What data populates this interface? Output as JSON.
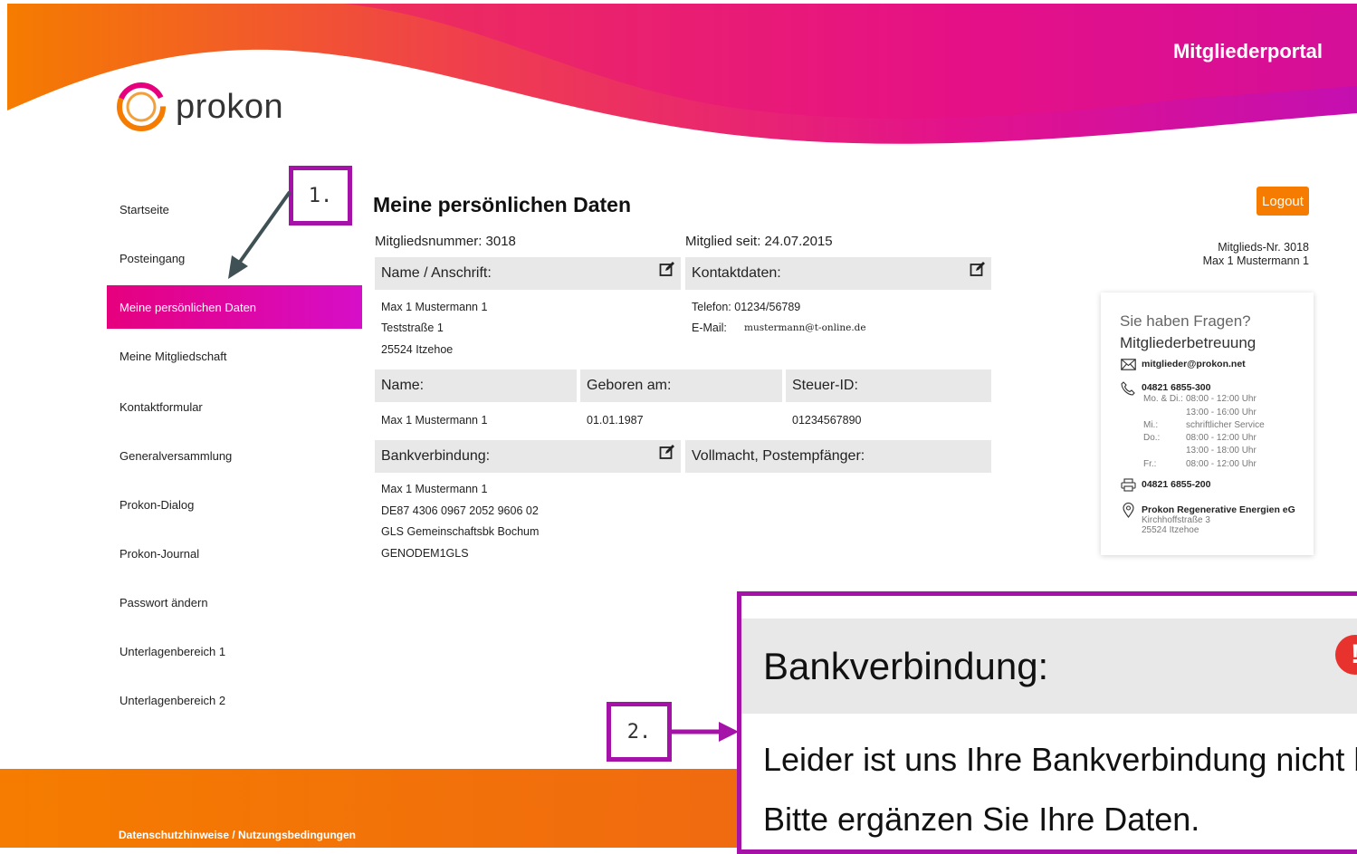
{
  "header": {
    "logo_text": "prokon",
    "portal_title": "Mitgliederportal"
  },
  "sidebar": {
    "items": [
      {
        "label": "Startseite"
      },
      {
        "label": "Posteingang"
      },
      {
        "label": "Meine persönlichen Daten",
        "active": true
      },
      {
        "label": "Meine Mitgliedschaft"
      },
      {
        "label": "Kontaktformular"
      },
      {
        "label": "Generalversammlung"
      },
      {
        "label": "Prokon-Dialog"
      },
      {
        "label": "Prokon-Journal"
      },
      {
        "label": "Passwort ändern"
      },
      {
        "label": "Unterlagenbereich 1"
      },
      {
        "label": "Unterlagenbereich 2"
      }
    ]
  },
  "main": {
    "title": "Meine persönlichen Daten",
    "member_number": "Mitgliedsnummer: 3018",
    "member_since": "Mitglied seit: 24.07.2015",
    "name_address": {
      "heading": "Name / Anschrift:",
      "lines": [
        "Max 1 Mustermann 1",
        "Teststraße 1",
        "25524 Itzehoe"
      ]
    },
    "contact": {
      "heading": "Kontaktdaten:",
      "phone": "Telefon: 01234/56789",
      "email_label": "E-Mail:",
      "email_value": "mustermann@t-online.de"
    },
    "person": {
      "name_heading": "Name:",
      "birth_heading": "Geboren am:",
      "tax_heading": "Steuer-ID:",
      "name_value": "Max 1 Mustermann 1",
      "birth_value": "01.01.1987",
      "tax_value": "01234567890"
    },
    "bank": {
      "heading": "Bankverbindung:",
      "lines": [
        "Max 1 Mustermann 1",
        "DE87 4306 0967 2052 9606 02",
        "GLS Gemeinschaftsbk Bochum",
        "GENODEM1GLS"
      ]
    },
    "proxy": {
      "heading": "Vollmacht, Postempfänger:"
    }
  },
  "right": {
    "logout_label": "Logout",
    "member_nr": "Mitglieds-Nr. 3018",
    "member_name": "Max 1 Mustermann 1",
    "help": {
      "question": "Sie haben Fragen?",
      "title": "Mitgliederbetreuung",
      "email": "mitglieder@prokon.net",
      "phone": "04821 6855-300",
      "hours": [
        {
          "day": "Mo. & Di.:",
          "time": "08:00 - 12:00 Uhr"
        },
        {
          "day": "",
          "time": "13:00 - 16:00 Uhr"
        },
        {
          "day": "Mi.:",
          "time": "schriftlicher Service"
        },
        {
          "day": "Do.:",
          "time": "08:00 - 12:00 Uhr"
        },
        {
          "day": "",
          "time": "13:00 - 18:00 Uhr"
        },
        {
          "day": "Fr.:",
          "time": "08:00 - 12:00 Uhr"
        }
      ],
      "fax": "04821 6855-200",
      "company": "Prokon Regenerative Energien eG",
      "street": "Kirchhoffstraße 3",
      "city": "25524 Itzehoe"
    }
  },
  "annotations": {
    "step1": "1.",
    "step2": "2.",
    "zoom_heading": "Bankverbindung:",
    "zoom_line1": "Leider ist uns Ihre Bankverbindung nicht b",
    "zoom_line2": "Bitte ergänzen Sie Ihre Daten.",
    "alert_symbol": "!"
  },
  "footer": {
    "link": "Datenschutzhinweise / Nutzungsbedingungen"
  },
  "colors": {
    "accent_magenta": "#e6007e",
    "accent_orange": "#f57c00",
    "annotation_purple": "#a412a7"
  }
}
